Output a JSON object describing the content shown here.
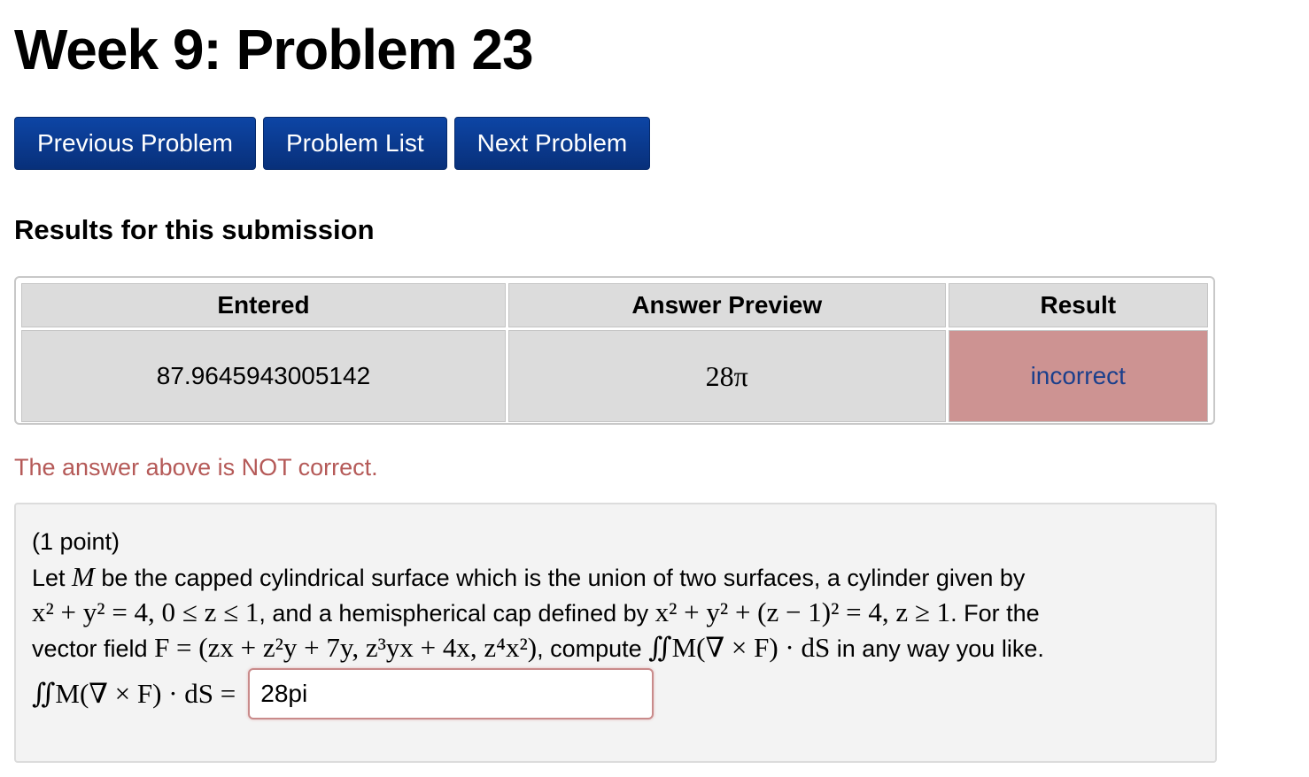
{
  "page": {
    "title": "Week 9: Problem 23"
  },
  "nav": {
    "previous_label": "Previous Problem",
    "list_label": "Problem List",
    "next_label": "Next Problem"
  },
  "results": {
    "heading": "Results for this submission",
    "columns": [
      "Entered",
      "Answer Preview",
      "Result"
    ],
    "row": {
      "entered": "87.9645943005142",
      "preview": "28π",
      "result": "incorrect"
    },
    "status_message": "The answer above is NOT correct."
  },
  "problem": {
    "points": "(1 point)",
    "line1": {
      "text_a": "Let ",
      "var_m": "M",
      "text_b": " be the capped cylindrical surface which is the union of two surfaces, a cylinder given by"
    },
    "line2": {
      "cylinder_eq": "x² + y² = 4,  0 ≤ z ≤ 1",
      "text_a": ", and a hemispherical cap defined by ",
      "cap_eq": "x² + y² + (z − 1)² = 4,  z ≥ 1",
      "text_b": ". For the"
    },
    "line3": {
      "text_a": "vector field ",
      "field_eq": "F = (zx + z²y + 7y,  z³yx + 4x,  z⁴x²)",
      "text_b": ", compute ",
      "integral": "∬M(∇ × F) · dS",
      "text_c": " in any way you like."
    },
    "answer": {
      "label": "∬M(∇ × F) · dS =",
      "value": "28pi"
    }
  },
  "colors": {
    "button_bg": "#0b3a8f",
    "incorrect_bg": "#cd9392",
    "incorrect_text": "#1a3f8c",
    "status_text": "#b55a58",
    "problem_bg": "#f3f3f3"
  }
}
